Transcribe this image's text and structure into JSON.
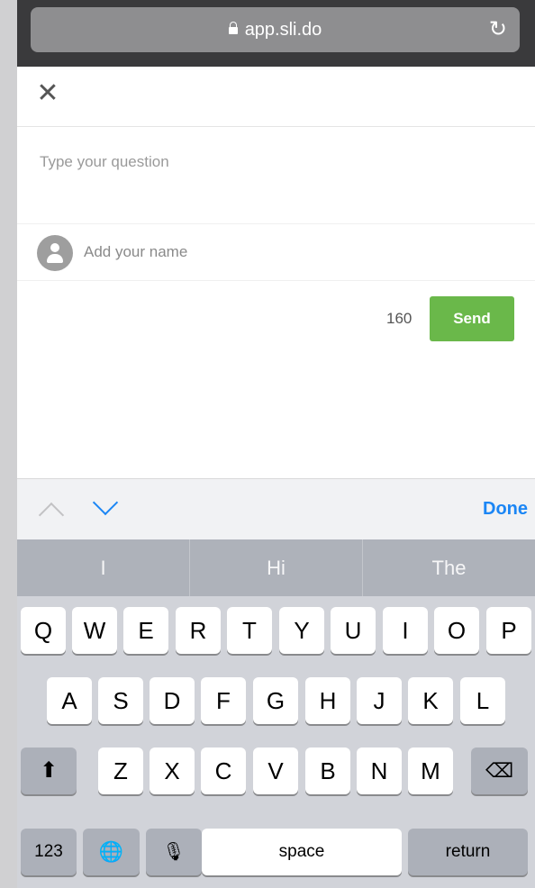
{
  "browser": {
    "url": "app.sli.do"
  },
  "compose": {
    "question_placeholder": "Type your question",
    "name_placeholder": "Add your name",
    "char_count": "160",
    "send_label": "Send"
  },
  "accessory": {
    "done_label": "Done"
  },
  "predictions": [
    "I",
    "Hi",
    "The"
  ],
  "keyboard": {
    "row1": [
      "Q",
      "W",
      "E",
      "R",
      "T",
      "Y",
      "U",
      "I",
      "O",
      "P"
    ],
    "row2": [
      "A",
      "S",
      "D",
      "F",
      "G",
      "H",
      "J",
      "K",
      "L"
    ],
    "row3": [
      "Z",
      "X",
      "C",
      "V",
      "B",
      "N",
      "M"
    ],
    "numbers_label": "123",
    "space_label": "space",
    "return_label": "return"
  },
  "colors": {
    "send": "#6ab84a",
    "accent": "#1b86f5",
    "browser_bar": "#3a3a3c"
  }
}
